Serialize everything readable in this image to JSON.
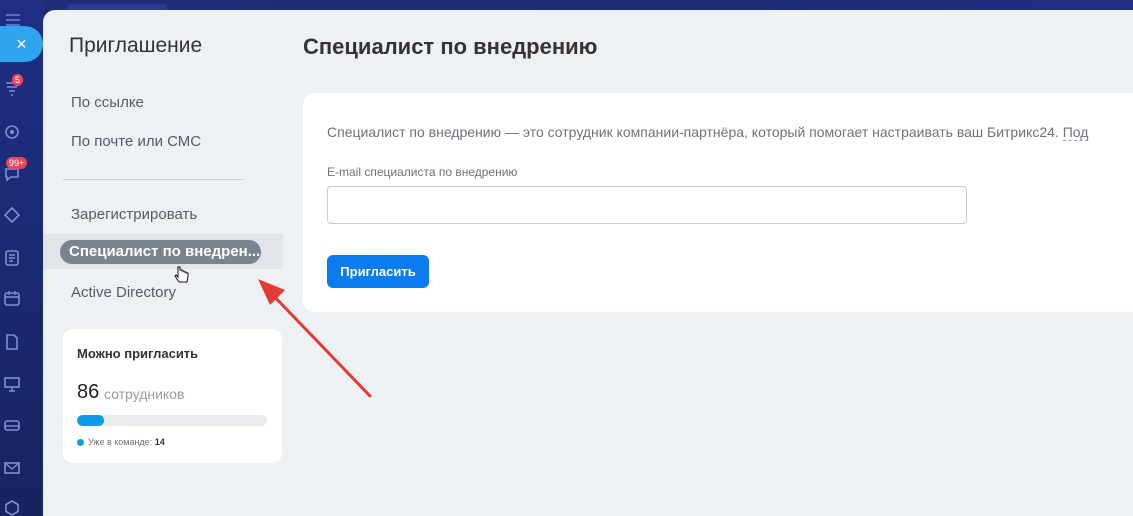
{
  "rail": {
    "badges": {
      "feed": "5",
      "chat": "99+"
    },
    "icons": [
      "menu-icon",
      "feed-icon",
      "collab-icon",
      "chat-icon",
      "tasks-icon",
      "docs-icon",
      "calendar-icon",
      "file-icon",
      "presentation-icon",
      "drive-icon",
      "mail-icon",
      "settings-icon"
    ]
  },
  "close_button": {
    "label": "×"
  },
  "sidebar": {
    "title": "Приглашение",
    "items": [
      {
        "label": "По ссылке"
      },
      {
        "label": "По почте или СМС"
      },
      {
        "label": "Зарегистрировать"
      },
      {
        "label": "Специалист по внедрен..."
      },
      {
        "label": "Active Directory"
      }
    ],
    "active_index": 3
  },
  "invite_card": {
    "label": "Можно пригласить",
    "count": "86",
    "unit": "сотрудников",
    "progress_fraction": 0.14,
    "legend_text": "Уже в команде:",
    "legend_value": "14"
  },
  "main": {
    "title": "Специалист по внедрению",
    "description": "Специалист по внедрению — это сотрудник компании-партнёра, который помогает настраивать ваш Битрикс24.",
    "description_more": "Под",
    "email_label": "E-mail специалиста по внедрению",
    "email_value": "",
    "invite_button": "Пригласить"
  },
  "colors": {
    "accent": "#0b7cf0",
    "progress": "#0f9be5",
    "annotation_arrow": "#e53935"
  }
}
